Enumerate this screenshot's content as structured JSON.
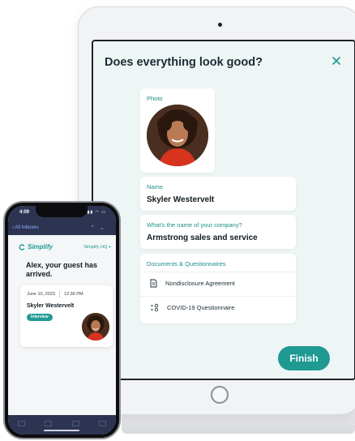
{
  "tablet": {
    "dialog": {
      "title": "Does everything look good?",
      "close_icon": "close-icon"
    },
    "photo": {
      "label": "Photo"
    },
    "name": {
      "label": "Name",
      "value": "Skyler Westervelt"
    },
    "company": {
      "label": "What's the name of your company?",
      "value": "Armstrong sales and service"
    },
    "documents": {
      "label": "Documents & Questionnaires",
      "items": [
        {
          "icon": "document-icon",
          "label": "Nondisclosure Agreement"
        },
        {
          "icon": "checklist-icon",
          "label": "COVID-19 Questionnaire"
        }
      ]
    },
    "finish_label": "Finish",
    "colors": {
      "accent": "#1f9a93",
      "screen_bg": "#eef5f5"
    }
  },
  "phone": {
    "status": {
      "time": "4:09",
      "icons": "signal wifi battery"
    },
    "nav": {
      "back_label": "All Inboxes"
    },
    "brand": {
      "name": "Simplify",
      "logo_icon": "simplify-logo-icon"
    },
    "location": "Simplify HQ",
    "message": "Alex, your guest has arrived.",
    "visit": {
      "date": "June 10, 2023",
      "time": "12:36 PM",
      "name": "Skyler Westervelt",
      "badge": "Interview"
    },
    "colors": {
      "header_bg": "#2d3452",
      "accent": "#1f9a93"
    }
  }
}
